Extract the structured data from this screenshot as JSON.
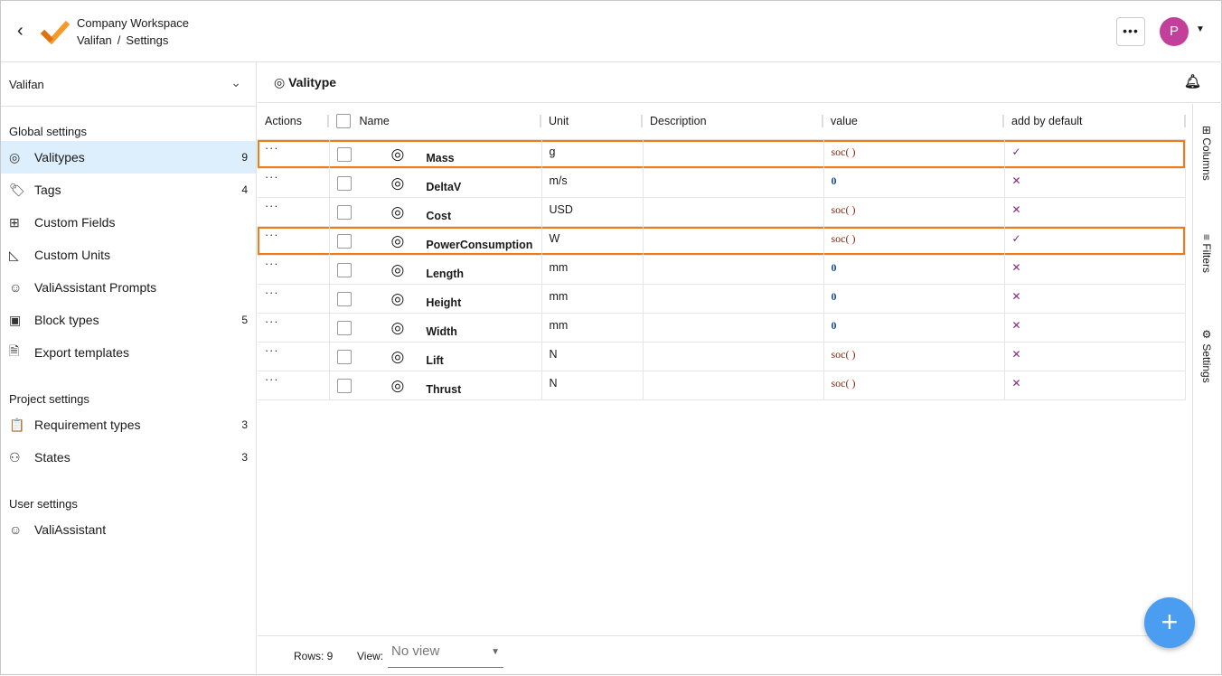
{
  "header": {
    "workspace": "Company Workspace",
    "crumbs": [
      "Valifan",
      "/",
      "Settings"
    ],
    "avatar": "P",
    "more": "•••"
  },
  "sidebar": {
    "project": "Valifan",
    "sections": [
      {
        "title": "Global settings",
        "items": [
          {
            "label": "Valitypes",
            "count": "9",
            "icon": "◎"
          },
          {
            "label": "Tags",
            "count": "4",
            "icon": "🏷"
          },
          {
            "label": "Custom Fields",
            "count": "",
            "icon": "⊞"
          },
          {
            "label": "Custom Units",
            "count": "",
            "icon": "◺"
          },
          {
            "label": "ValiAssistant Prompts",
            "count": "",
            "icon": "☺"
          },
          {
            "label": "Block types",
            "count": "5",
            "icon": "▣"
          },
          {
            "label": "Export templates",
            "count": "",
            "icon": "🗎"
          }
        ]
      },
      {
        "title": "Project settings",
        "items": [
          {
            "label": "Requirement types",
            "count": "3",
            "icon": "📋"
          },
          {
            "label": "States",
            "count": "3",
            "icon": "⚇"
          }
        ]
      },
      {
        "title": "User settings",
        "items": [
          {
            "label": "ValiAssistant",
            "count": "",
            "icon": "☺"
          }
        ]
      }
    ]
  },
  "main": {
    "title": "Valitype",
    "columns": [
      "Actions",
      "Name",
      "Unit",
      "Description",
      "value",
      "add by default"
    ],
    "rows": [
      {
        "name": "Mass",
        "unit": "g",
        "desc": "",
        "value": "soc( )",
        "default": "✓",
        "highlight": true
      },
      {
        "name": "DeltaV",
        "unit": "m/s",
        "desc": "",
        "value": "0",
        "default": "✕",
        "highlight": false
      },
      {
        "name": "Cost",
        "unit": "USD",
        "desc": "",
        "value": "soc( )",
        "default": "✕",
        "highlight": false
      },
      {
        "name": "PowerConsumption",
        "unit": "W",
        "desc": "",
        "value": "soc( )",
        "default": "✓",
        "highlight": true
      },
      {
        "name": "Length",
        "unit": "mm",
        "desc": "",
        "value": "0",
        "default": "✕",
        "highlight": false
      },
      {
        "name": "Height",
        "unit": "mm",
        "desc": "",
        "value": "0",
        "default": "✕",
        "highlight": false
      },
      {
        "name": "Width",
        "unit": "mm",
        "desc": "",
        "value": "0",
        "default": "✕",
        "highlight": false
      },
      {
        "name": "Lift",
        "unit": "N",
        "desc": "",
        "value": "soc( )",
        "default": "✕",
        "highlight": false
      },
      {
        "name": "Thrust",
        "unit": "N",
        "desc": "",
        "value": "soc( )",
        "default": "✕",
        "highlight": false
      }
    ],
    "right_panel": [
      "Columns",
      "Filters",
      "Settings"
    ],
    "footer": {
      "rows_label": "Rows: 9",
      "view_label": "View:",
      "view_value": "No view"
    }
  },
  "colors": {
    "highlight": "#f57a14",
    "accent": "#4a9df0",
    "active": "#ddeefc"
  }
}
